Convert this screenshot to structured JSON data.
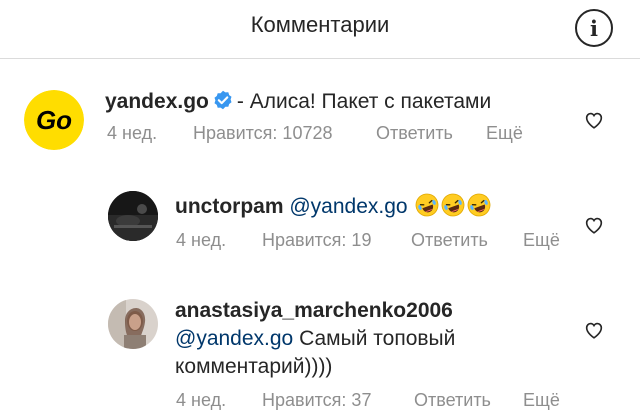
{
  "header": {
    "title": "Комментарии",
    "info_icon": "info-icon"
  },
  "comments": [
    {
      "username": "yandex.go",
      "verified": true,
      "text": "- Алиса! Пакет с пакетами",
      "time": "4 нед.",
      "likes": "Нравится: 10728",
      "reply": "Ответить",
      "more": "Ещё",
      "avatar_text": "Go"
    },
    {
      "username": "unctorpam",
      "mention": "@yandex.go",
      "emoji": [
        "rolling-on-floor-laughing-emoji",
        "rolling-on-floor-laughing-emoji",
        "rolling-on-floor-laughing-emoji"
      ],
      "time": "4 нед.",
      "likes": "Нравится: 19",
      "reply": "Ответить",
      "more": "Ещё"
    },
    {
      "username": "anastasiya_marchenko2006",
      "mention": "@yandex.go",
      "text_line1": "Самый топовый",
      "text_line2": "комментарий))))",
      "time": "4 нед.",
      "likes": "Нравится: 37",
      "reply": "Ответить",
      "more": "Ещё"
    }
  ],
  "colors": {
    "mention": "#00376b",
    "verified": "#3897f0",
    "meta": "#8e8e8e",
    "yandex_avatar": "#ffdd00"
  }
}
